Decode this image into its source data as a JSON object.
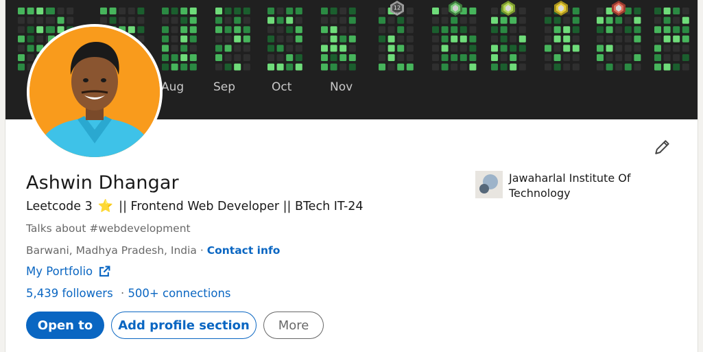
{
  "banner": {
    "months": [
      "Aug",
      "Sep",
      "Oct",
      "Nov"
    ],
    "badges": [
      "badge-2022-icon",
      "badge-green-icon",
      "badge-lime-icon",
      "badge-yellow-icon",
      "badge-red-icon"
    ],
    "badge_text": "12",
    "badge_year": "2022",
    "colors": {
      "background": "#202020",
      "empty_cell": "#2f2f2f",
      "level1": "#1b5e2e",
      "level2": "#2b8a43",
      "level3": "#47b55c",
      "level4": "#6fdc7a"
    }
  },
  "profile": {
    "name": "Ashwin Dhangar",
    "headline_prefix": "Leetcode 3",
    "headline_star": "⭐",
    "headline_suffix": "|| Frontend Web Developer || BTech IT-24",
    "talks_about": "Talks about #webdevelopment",
    "location": "Barwani, Madhya Pradesh, India",
    "location_separator": "·",
    "contact_info": "Contact info",
    "portfolio": "My Portfolio",
    "followers": "5,439 followers",
    "network_separator": "·",
    "connections": "500+ connections",
    "avatar_bg": "#f99b1c"
  },
  "actions": {
    "open_to": "Open to",
    "add_section": "Add profile section",
    "more": "More"
  },
  "education": {
    "school_name": "Jawaharlal Institute Of Technology"
  },
  "theme": {
    "accent": "#0a66c2"
  }
}
